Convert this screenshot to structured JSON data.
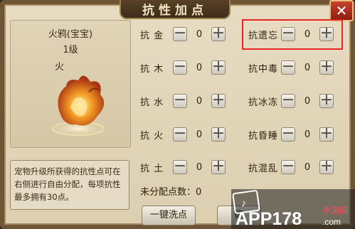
{
  "title": "抗性加点",
  "close_label": "✕",
  "pet": {
    "name": "火鸦(宝宝)",
    "level": "1级",
    "element": "火"
  },
  "description": "宠物升级所获得的抗性点可在右侧进行自由分配，每项抗性最多拥有30点。",
  "left_stats": [
    {
      "label": "抗 金",
      "value": "0"
    },
    {
      "label": "抗 木",
      "value": "0"
    },
    {
      "label": "抗 水",
      "value": "0"
    },
    {
      "label": "抗 火",
      "value": "0"
    },
    {
      "label": "抗 土",
      "value": "0"
    }
  ],
  "right_stats": [
    {
      "label": "抗遗忘",
      "value": "0"
    },
    {
      "label": "抗中毒",
      "value": "0"
    },
    {
      "label": "抗冰冻",
      "value": "0"
    },
    {
      "label": "抗昏睡",
      "value": "0"
    },
    {
      "label": "抗混乱",
      "value": "0"
    }
  ],
  "minus_symbol": "－",
  "plus_symbol": "＋",
  "unallocated": "未分配点数：0",
  "wash_button": "一键洗点",
  "confirm_button": "确",
  "watermark": {
    "main": "APP178",
    "sub": "手游网",
    "domain": ".com"
  },
  "colors": {
    "highlight": "#e52521",
    "frame": "#6d5535"
  }
}
